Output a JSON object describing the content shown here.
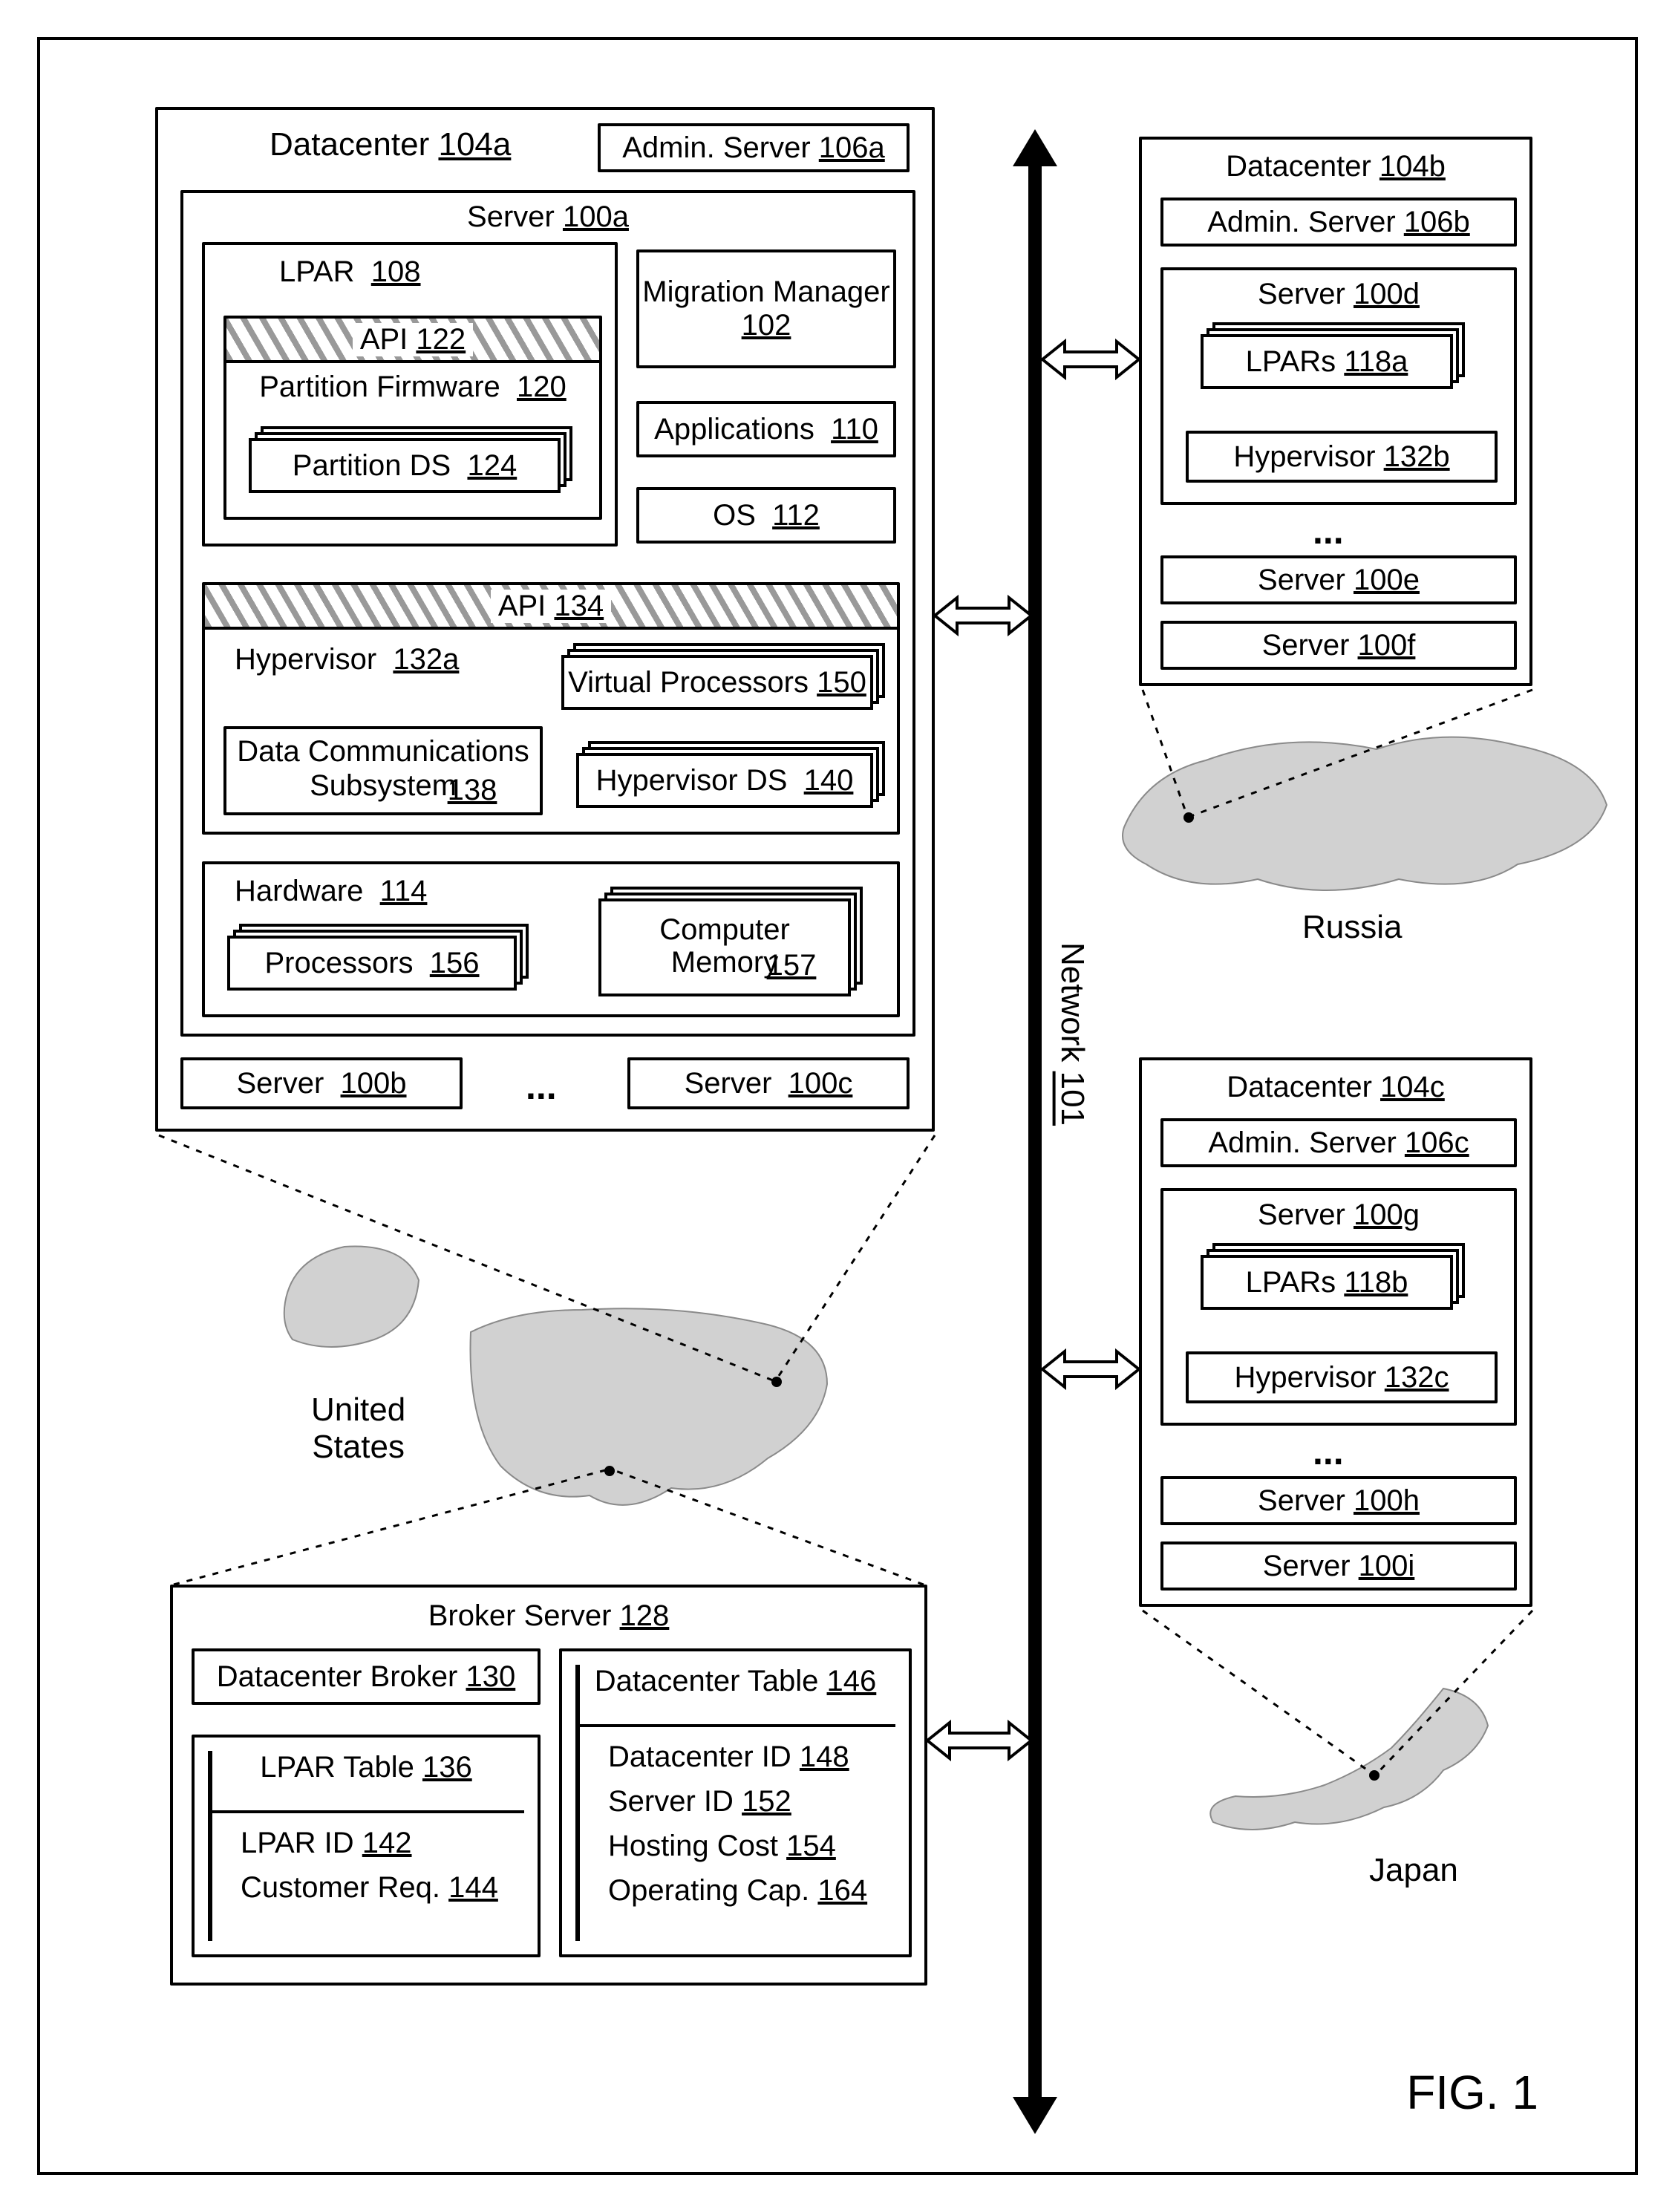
{
  "figure": "FIG. 1",
  "network": {
    "label": "Network",
    "ref": "101"
  },
  "regions": {
    "us": "United\nStates",
    "russia": "Russia",
    "japan": "Japan"
  },
  "dc_a": {
    "title": "Datacenter",
    "title_ref": "104a",
    "admin": "Admin. Server",
    "admin_ref": "106a",
    "server": "Server",
    "server_ref": "100a",
    "lpar": "LPAR",
    "lpar_ref": "108",
    "api1": "API",
    "api1_ref": "122",
    "pf": "Partition Firmware",
    "pf_ref": "120",
    "pds": "Partition DS",
    "pds_ref": "124",
    "mm": "Migration Manager",
    "mm_ref": "102",
    "apps": "Applications",
    "apps_ref": "110",
    "os": "OS",
    "os_ref": "112",
    "api2": "API",
    "api2_ref": "134",
    "hyp": "Hypervisor",
    "hyp_ref": "132a",
    "vp": "Virtual Processors",
    "vp_ref": "150",
    "dcs": "Data Communications\nSubsystem",
    "dcs_ref": "138",
    "hds": "Hypervisor DS",
    "hds_ref": "140",
    "hw": "Hardware",
    "hw_ref": "114",
    "proc": "Processors",
    "proc_ref": "156",
    "mem": "Computer\nMemory",
    "mem_ref": "157",
    "srv_b": "Server",
    "srv_b_ref": "100b",
    "srv_c": "Server",
    "srv_c_ref": "100c"
  },
  "dc_b": {
    "title": "Datacenter",
    "title_ref": "104b",
    "admin": "Admin. Server",
    "admin_ref": "106b",
    "server": "Server",
    "server_ref": "100d",
    "lpars": "LPARs",
    "lpars_ref": "118a",
    "hyp": "Hypervisor",
    "hyp_ref": "132b",
    "srv_e": "Server",
    "srv_e_ref": "100e",
    "srv_f": "Server",
    "srv_f_ref": "100f"
  },
  "dc_c": {
    "title": "Datacenter",
    "title_ref": "104c",
    "admin": "Admin. Server",
    "admin_ref": "106c",
    "server": "Server",
    "server_ref": "100g",
    "lpars": "LPARs",
    "lpars_ref": "118b",
    "hyp": "Hypervisor",
    "hyp_ref": "132c",
    "srv_h": "Server",
    "srv_h_ref": "100h",
    "srv_i": "Server",
    "srv_i_ref": "100i"
  },
  "broker": {
    "title": "Broker Server",
    "title_ref": "128",
    "db": "Datacenter Broker",
    "db_ref": "130",
    "lt": "LPAR Table",
    "lt_ref": "136",
    "lid": "LPAR ID",
    "lid_ref": "142",
    "creq": "Customer Req.",
    "creq_ref": "144",
    "dtab": "Datacenter Table",
    "dtab_ref": "146",
    "dc_id": "Datacenter ID",
    "dc_id_ref": "148",
    "s_id": "Server ID",
    "s_id_ref": "152",
    "hc": "Hosting Cost",
    "hc_ref": "154",
    "oc": "Operating Cap.",
    "oc_ref": "164"
  }
}
